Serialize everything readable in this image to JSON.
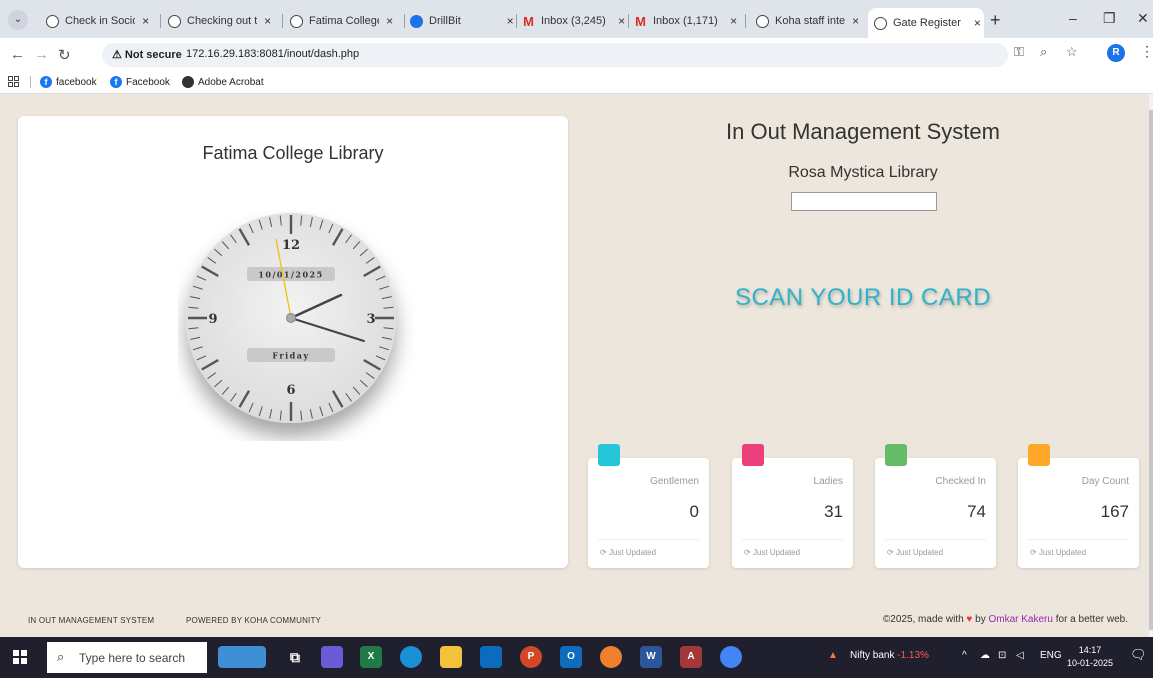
{
  "browser": {
    "tabs": [
      {
        "label": "Check in Socio",
        "icon": "globe-icon"
      },
      {
        "label": "Checking out t",
        "icon": "globe-icon"
      },
      {
        "label": "Fatima College",
        "icon": "globe-icon"
      },
      {
        "label": "DrillBit",
        "icon": "drillbit-icon"
      },
      {
        "label": "Inbox (3,245)",
        "icon": "gmail-icon"
      },
      {
        "label": "Inbox (1,171)",
        "icon": "gmail-icon"
      },
      {
        "label": "Koha staff inte",
        "icon": "globe-icon"
      },
      {
        "label": "Gate Register",
        "icon": "globe-icon",
        "active": true
      }
    ],
    "security_label": "Not secure",
    "url": "172.16.29.183:8081/inout/dash.php",
    "profile_initial": "R",
    "bookmarks": [
      "facebook",
      "Facebook",
      "Adobe Acrobat"
    ]
  },
  "clock": {
    "library_name": "Fatima College Library",
    "date": "10/01/2025",
    "day": "Friday",
    "numerals": {
      "twelve": "12",
      "three": "3",
      "six": "6",
      "nine": "9"
    }
  },
  "header": {
    "system_title": "In Out Management System",
    "library_name": "Rosa Mystica Library",
    "scan_message": "SCAN YOUR ID CARD"
  },
  "stats": [
    {
      "label": "Gentlemen",
      "value": "0",
      "footer": "Just Updated",
      "color": "#26c6da"
    },
    {
      "label": "Ladies",
      "value": "31",
      "footer": "Just Updated",
      "color": "#ec407a"
    },
    {
      "label": "Checked In",
      "value": "74",
      "footer": "Just Updated",
      "color": "#66bb6a"
    },
    {
      "label": "Day Count",
      "value": "167",
      "footer": "Just Updated",
      "color": "#ffa726"
    }
  ],
  "footer": {
    "left_1": "IN OUT MANAGEMENT SYSTEM",
    "left_2": "POWERED BY KOHA COMMUNITY",
    "right_prefix": "©2025, made with",
    "right_by": "by",
    "right_author": "Omkar Kakeru",
    "right_suffix": "for a better web."
  },
  "taskbar": {
    "search_placeholder": "Type here to search",
    "ticker_label": "Nifty bank",
    "ticker_change": "-1.13%",
    "language": "ENG",
    "time": "14:17",
    "date": "10-01-2025"
  }
}
